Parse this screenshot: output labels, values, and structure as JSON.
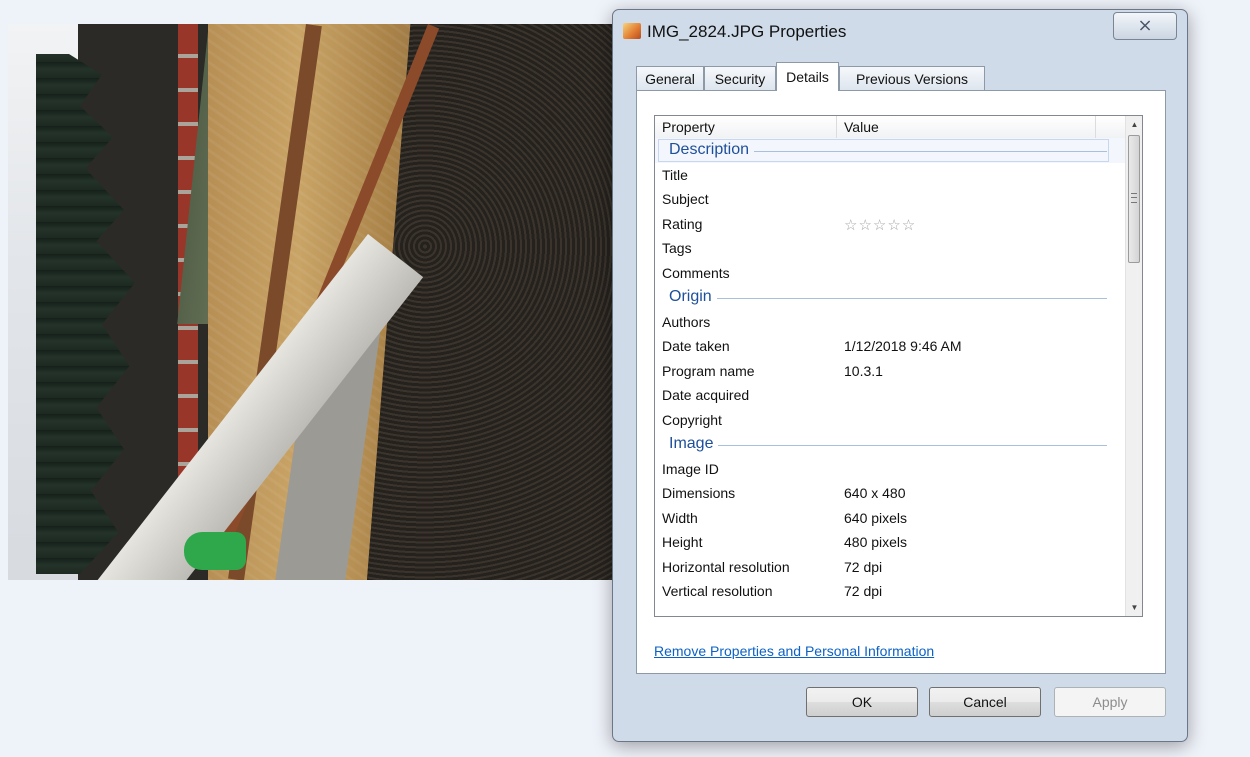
{
  "dialog": {
    "title": "IMG_2824.JPG Properties",
    "close_glyph": "⨯",
    "icon": "jpg-file-icon"
  },
  "tabs": [
    {
      "label": "General"
    },
    {
      "label": "Security"
    },
    {
      "label": "Details",
      "active": true
    },
    {
      "label": "Previous Versions"
    }
  ],
  "details": {
    "header": {
      "property": "Property",
      "value": "Value"
    },
    "rows": [
      {
        "kind": "group",
        "label": "Description"
      },
      {
        "kind": "row",
        "property": "Title",
        "value": ""
      },
      {
        "kind": "row",
        "property": "Subject",
        "value": ""
      },
      {
        "kind": "row",
        "property": "Rating",
        "value": "☆☆☆☆☆"
      },
      {
        "kind": "row",
        "property": "Tags",
        "value": ""
      },
      {
        "kind": "row",
        "property": "Comments",
        "value": ""
      },
      {
        "kind": "group",
        "label": "Origin"
      },
      {
        "kind": "row",
        "property": "Authors",
        "value": ""
      },
      {
        "kind": "row",
        "property": "Date taken",
        "value": "1/12/2018 9:46 AM"
      },
      {
        "kind": "row",
        "property": "Program name",
        "value": "10.3.1"
      },
      {
        "kind": "row",
        "property": "Date acquired",
        "value": ""
      },
      {
        "kind": "row",
        "property": "Copyright",
        "value": ""
      },
      {
        "kind": "group",
        "label": "Image"
      },
      {
        "kind": "row",
        "property": "Image ID",
        "value": ""
      },
      {
        "kind": "row",
        "property": "Dimensions",
        "value": "640 x 480"
      },
      {
        "kind": "row",
        "property": "Width",
        "value": "640 pixels"
      },
      {
        "kind": "row",
        "property": "Height",
        "value": "480 pixels"
      },
      {
        "kind": "row",
        "property": "Horizontal resolution",
        "value": "72 dpi"
      },
      {
        "kind": "row",
        "property": "Vertical resolution",
        "value": "72 dpi"
      }
    ]
  },
  "remove_link": "Remove Properties and Personal Information",
  "buttons": {
    "ok": "OK",
    "cancel": "Cancel",
    "apply": "Apply"
  }
}
